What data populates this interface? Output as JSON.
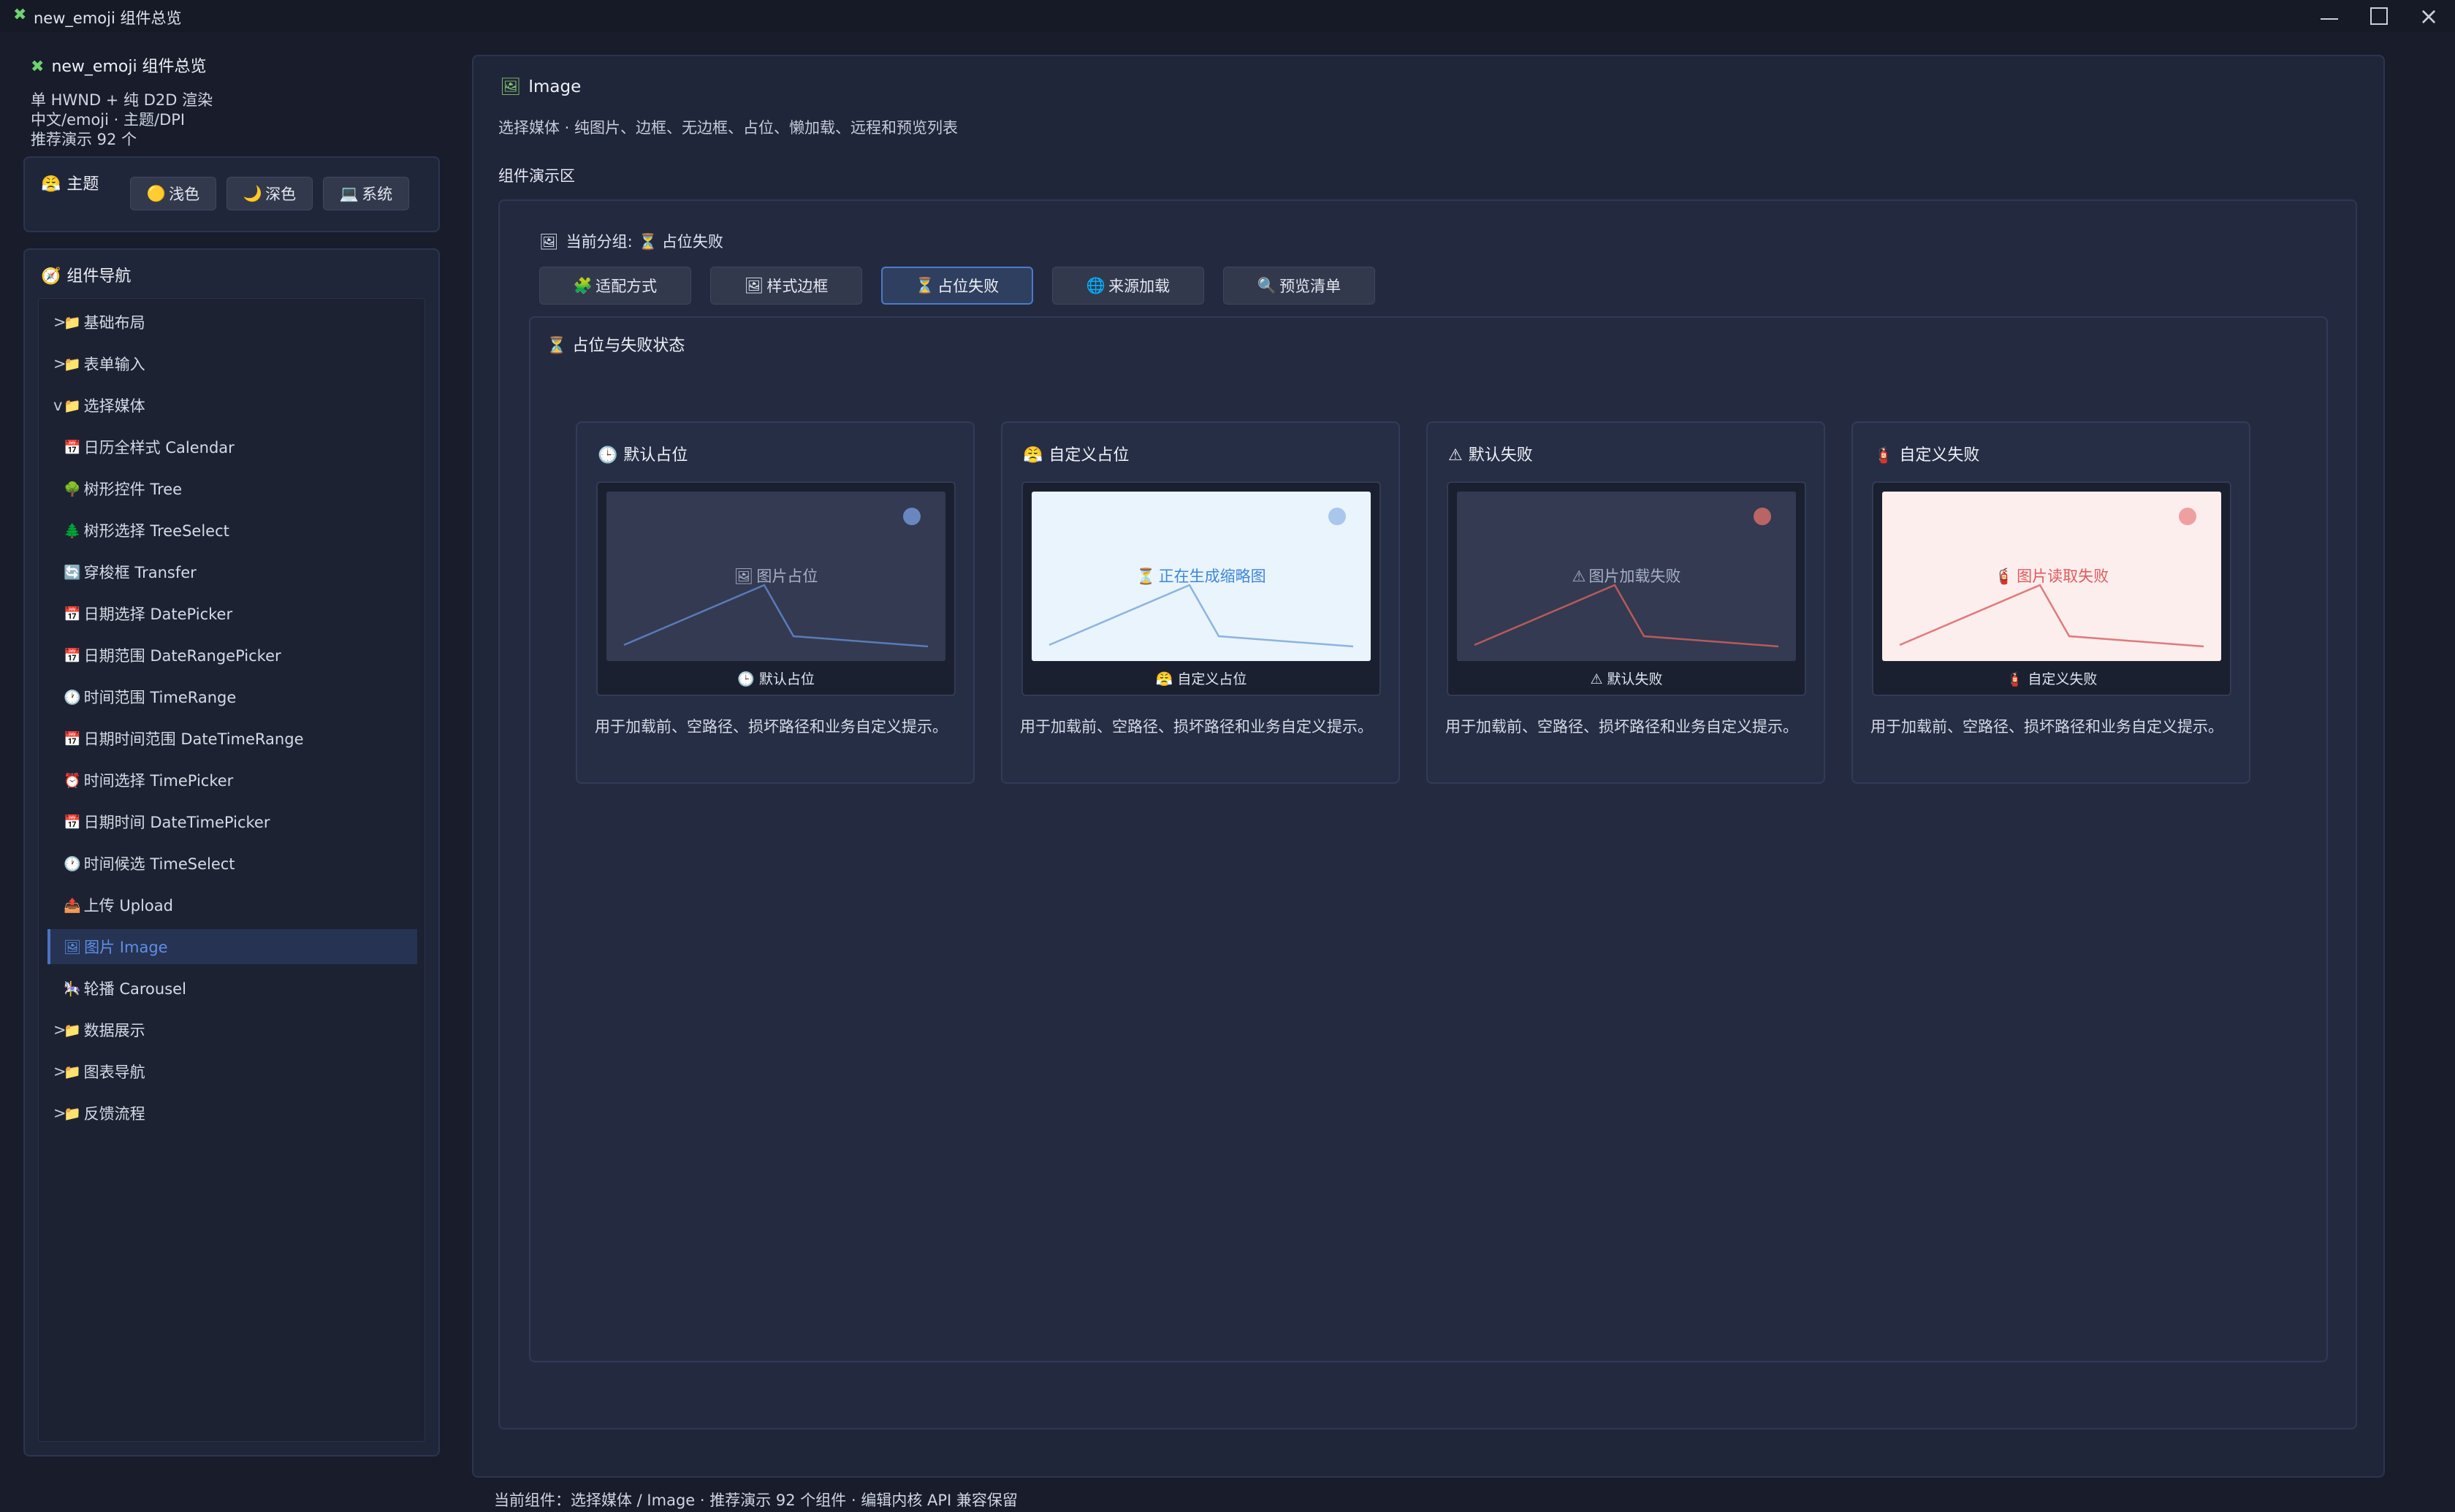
{
  "window": {
    "icon": "puzzle-icon",
    "title": "new_emoji 组件总览"
  },
  "sidebar": {
    "app_title": "new_emoji 组件总览",
    "info_lines": [
      "单 HWND + 纯 D2D 渲染",
      "中文/emoji · 主题/DPI",
      "推荐演示 92 个"
    ],
    "theme": {
      "label": "主题",
      "buttons": [
        {
          "label": "浅色",
          "icon": "🟡"
        },
        {
          "label": "深色",
          "icon": "🌙"
        },
        {
          "label": "系统",
          "icon": "💻"
        }
      ]
    },
    "nav": {
      "title": "组件导航",
      "items": [
        {
          "arrow": ">",
          "icon": "📁",
          "label": "基础布局"
        },
        {
          "arrow": ">",
          "icon": "📁",
          "label": "表单输入"
        },
        {
          "arrow": "v",
          "icon": "📁",
          "label": "选择媒体"
        },
        {
          "icon": "📅",
          "label": "日历全样式 Calendar"
        },
        {
          "icon": "🌳",
          "label": "树形控件 Tree"
        },
        {
          "icon": "🌲",
          "label": "树形选择 TreeSelect"
        },
        {
          "icon": "🔄",
          "label": "穿梭框 Transfer"
        },
        {
          "icon": "📅",
          "label": "日期选择 DatePicker"
        },
        {
          "icon": "📅",
          "label": "日期范围 DateRangePicker"
        },
        {
          "icon": "🕐",
          "label": "时间范围 TimeRange"
        },
        {
          "icon": "📅",
          "label": "日期时间范围 DateTimeRange"
        },
        {
          "icon": "⏰",
          "label": "时间选择 TimePicker"
        },
        {
          "icon": "📅",
          "label": "日期时间 DateTimePicker"
        },
        {
          "icon": "🕐",
          "label": "时间候选 TimeSelect"
        },
        {
          "icon": "📤",
          "label": "上传 Upload"
        },
        {
          "icon": "🖼",
          "label": "图片 Image"
        },
        {
          "icon": "🎠",
          "label": "轮播 Carousel"
        },
        {
          "arrow": ">",
          "icon": "📁",
          "label": "数据展示"
        },
        {
          "arrow": ">",
          "icon": "📁",
          "label": "图表导航"
        },
        {
          "arrow": ">",
          "icon": "📁",
          "label": "反馈流程"
        }
      ],
      "active_index": 15
    }
  },
  "main": {
    "title": "Image",
    "title_icon": "🖼",
    "description": "选择媒体 · 纯图片、边框、无边框、占位、懒加载、远程和预览列表",
    "demo_label": "组件演示区",
    "group": {
      "prefix": "当前分组:",
      "icon": "⏳",
      "name": "占位失败"
    },
    "tabs": [
      {
        "icon": "🧩",
        "label": "适配方式"
      },
      {
        "icon": "🖼",
        "label": "样式边框"
      },
      {
        "icon": "⏳",
        "label": "占位失败"
      },
      {
        "icon": "🌐",
        "label": "来源加载"
      },
      {
        "icon": "🔍",
        "label": "预览清单"
      }
    ],
    "active_tab": 2,
    "section_title": "占位与失败状态",
    "cards": [
      {
        "title": "默认占位",
        "title_icon": "🕒",
        "placeholder_icon": "🖼",
        "placeholder_text": "图片占位",
        "caption_icon": "🕒",
        "caption": "默认占位",
        "desc": "用于加载前、空路径、损坏路径和业务自定义提示。",
        "bg": "#333a52",
        "line_color": "#5a7bb8",
        "dot_color": "#6a86bf",
        "text_color": "#a7b0c4"
      },
      {
        "title": "自定义占位",
        "title_icon": "😤",
        "placeholder_icon": "⏳",
        "placeholder_text": "正在生成缩略图",
        "caption_icon": "😤",
        "caption": "自定义占位",
        "desc": "用于加载前、空路径、损坏路径和业务自定义提示。",
        "bg": "#eaf4fd",
        "line_color": "#8cb4e0",
        "dot_color": "#a9c6ec",
        "text_color": "#3d86d8"
      },
      {
        "title": "默认失败",
        "title_icon": "⚠",
        "placeholder_icon": "⚠",
        "placeholder_text": "图片加载失败",
        "caption_icon": "⚠",
        "caption": "默认失败",
        "desc": "用于加载前、空路径、损坏路径和业务自定义提示。",
        "bg": "#333a52",
        "line_color": "#b85a5a",
        "dot_color": "#b86565",
        "text_color": "#a7b0c4"
      },
      {
        "title": "自定义失败",
        "title_icon": "🧯",
        "placeholder_icon": "🧯",
        "placeholder_text": "图片读取失败",
        "caption_icon": "🧯",
        "caption": "自定义失败",
        "desc": "用于加载前、空路径、损坏路径和业务自定义提示。",
        "bg": "#fdeeee",
        "line_color": "#e07a7a",
        "dot_color": "#eea0a0",
        "text_color": "#e05a5a"
      }
    ]
  },
  "status": {
    "text": "当前组件：选择媒体 / Image · 推荐演示 92 个组件 · 编辑内核 API 兼容保留"
  }
}
